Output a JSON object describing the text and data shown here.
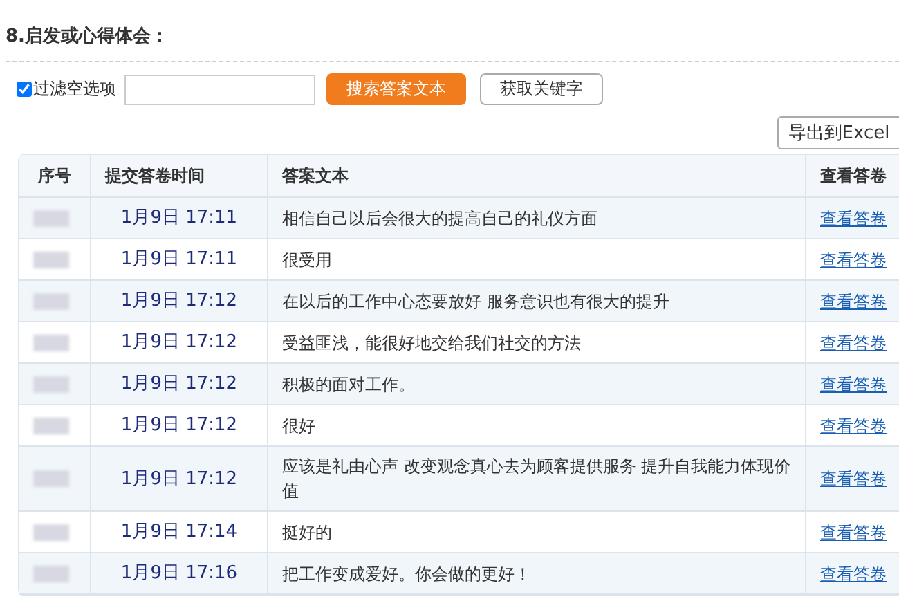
{
  "section_title": "8.启发或心得体会：",
  "toolbar": {
    "filter_checkbox": {
      "label": "过滤空选项",
      "checked": true
    },
    "search_button": "搜索答案文本",
    "keywords_button": "获取关键字"
  },
  "export_button": "导出到Excel",
  "table": {
    "columns": [
      "序号",
      "提交答卷时间",
      "答案文本",
      "查看答卷"
    ],
    "rows": [
      {
        "time": "1月9日 17:11",
        "text": "相信自己以后会很大的提高自己的礼仪方面",
        "link": "查看答卷"
      },
      {
        "time": "1月9日 17:11",
        "text": "很受用",
        "link": "查看答卷"
      },
      {
        "time": "1月9日 17:12",
        "text": "在以后的工作中心态要放好 服务意识也有很大的提升",
        "link": "查看答卷"
      },
      {
        "time": "1月9日 17:12",
        "text": "受益匪浅，能很好地交给我们社交的方法",
        "link": "查看答卷"
      },
      {
        "time": "1月9日 17:12",
        "text": "积极的面对工作。",
        "link": "查看答卷"
      },
      {
        "time": "1月9日 17:12",
        "text": "很好",
        "link": "查看答卷"
      },
      {
        "time": "1月9日 17:12",
        "text": "应该是礼由心声 改变观念真心去为顾客提供服务 提升自我能力体现价值",
        "link": "查看答卷"
      },
      {
        "time": "1月9日 17:14",
        "text": "挺好的",
        "link": "查看答卷"
      },
      {
        "time": "1月9日 17:16",
        "text": "把工作变成爱好。你会做的更好！",
        "link": "查看答卷"
      }
    ]
  }
}
